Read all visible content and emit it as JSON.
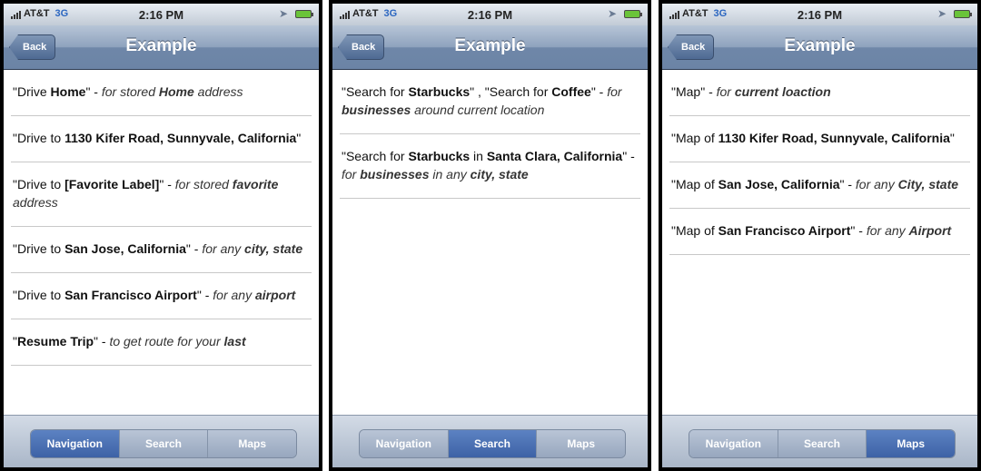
{
  "status": {
    "carrier": "AT&T",
    "network": "3G",
    "time": "2:16 PM"
  },
  "navbar": {
    "back_label": "Back",
    "title": "Example"
  },
  "tabs": [
    "Navigation",
    "Search",
    "Maps"
  ],
  "screens": [
    {
      "active_tab": "Navigation",
      "items": [
        {
          "segments": [
            {
              "t": "\"Drive "
            },
            {
              "t": "Home",
              "b": true
            },
            {
              "t": "\" - "
            },
            {
              "t": "for stored ",
              "i": true
            },
            {
              "t": "Home",
              "i": true,
              "b": true
            },
            {
              "t": " address",
              "i": true
            }
          ]
        },
        {
          "segments": [
            {
              "t": "\"Drive to "
            },
            {
              "t": "1130 Kifer Road, Sunnyvale, California",
              "b": true
            },
            {
              "t": "\""
            }
          ]
        },
        {
          "segments": [
            {
              "t": "\"Drive to "
            },
            {
              "t": "[Favorite Label]",
              "b": true
            },
            {
              "t": "\" - "
            },
            {
              "t": "for stored ",
              "i": true
            },
            {
              "t": "favorite",
              "i": true,
              "b": true
            },
            {
              "t": " address",
              "i": true
            }
          ]
        },
        {
          "segments": [
            {
              "t": "\"Drive to "
            },
            {
              "t": "San Jose, California",
              "b": true
            },
            {
              "t": "\" - "
            },
            {
              "t": "for any ",
              "i": true
            },
            {
              "t": "city, state",
              "i": true,
              "b": true
            }
          ]
        },
        {
          "segments": [
            {
              "t": "\"Drive to "
            },
            {
              "t": "San Francisco Airport",
              "b": true
            },
            {
              "t": "\" - "
            },
            {
              "t": "for any ",
              "i": true
            },
            {
              "t": "airport",
              "i": true,
              "b": true
            }
          ]
        },
        {
          "segments": [
            {
              "t": "\""
            },
            {
              "t": "Resume Trip",
              "b": true
            },
            {
              "t": "\" - "
            },
            {
              "t": "to get route for your ",
              "i": true
            },
            {
              "t": "last",
              "i": true,
              "b": true
            }
          ]
        }
      ]
    },
    {
      "active_tab": "Search",
      "items": [
        {
          "segments": [
            {
              "t": "\"Search for "
            },
            {
              "t": "Starbucks",
              "b": true
            },
            {
              "t": "\" , \"Search for "
            },
            {
              "t": "Coffee",
              "b": true
            },
            {
              "t": "\" - "
            },
            {
              "t": "for ",
              "i": true
            },
            {
              "t": "businesses",
              "i": true,
              "b": true
            },
            {
              "t": " around current location",
              "i": true
            }
          ]
        },
        {
          "segments": [
            {
              "t": "\"Search for "
            },
            {
              "t": "Starbucks",
              "b": true
            },
            {
              "t": " in "
            },
            {
              "t": "Santa Clara, California",
              "b": true
            },
            {
              "t": "\" - "
            },
            {
              "t": "for ",
              "i": true
            },
            {
              "t": "businesses",
              "i": true,
              "b": true
            },
            {
              "t": " in any ",
              "i": true
            },
            {
              "t": "city, state",
              "i": true,
              "b": true
            }
          ]
        }
      ]
    },
    {
      "active_tab": "Maps",
      "items": [
        {
          "segments": [
            {
              "t": "\"Map\" - "
            },
            {
              "t": "for ",
              "i": true
            },
            {
              "t": "current loaction",
              "i": true,
              "b": true
            }
          ]
        },
        {
          "segments": [
            {
              "t": "\"Map of "
            },
            {
              "t": "1130 Kifer Road, Sunnyvale, California",
              "b": true
            },
            {
              "t": "\""
            }
          ]
        },
        {
          "segments": [
            {
              "t": "\"Map of "
            },
            {
              "t": "San Jose, California",
              "b": true
            },
            {
              "t": "\" - "
            },
            {
              "t": "for any ",
              "i": true
            },
            {
              "t": "City, state",
              "i": true,
              "b": true
            }
          ]
        },
        {
          "segments": [
            {
              "t": "\"Map of "
            },
            {
              "t": "San Francisco Airport",
              "b": true
            },
            {
              "t": "\" - "
            },
            {
              "t": "for any ",
              "i": true
            },
            {
              "t": "Airport",
              "i": true,
              "b": true
            }
          ]
        }
      ]
    }
  ]
}
